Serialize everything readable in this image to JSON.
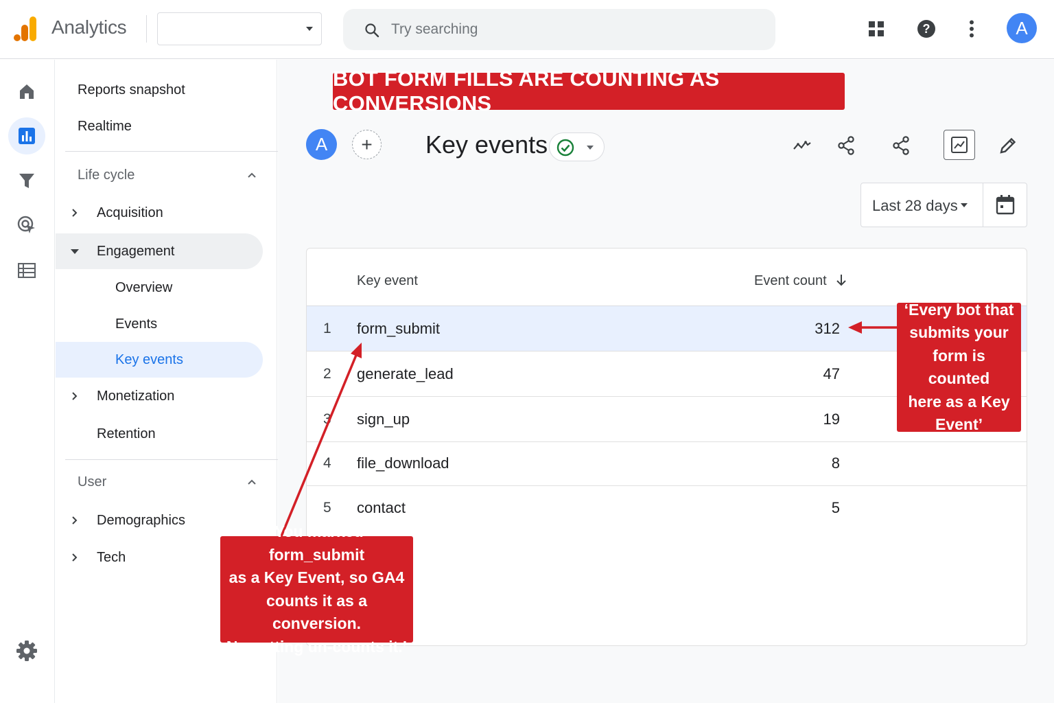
{
  "app": {
    "title": "Analytics",
    "account_selector_value": "",
    "accent_color": "#1a73e8",
    "avatar_letter": "A"
  },
  "search": {
    "placeholder": "Try searching"
  },
  "topbar_icons": [
    "apps-grid-icon",
    "help-icon",
    "more-vert-icon"
  ],
  "rail": {
    "items": [
      {
        "icon": "home-icon",
        "active": false
      },
      {
        "icon": "reports-icon",
        "active": true
      },
      {
        "icon": "explore-funnel-icon",
        "active": false
      },
      {
        "icon": "advertising-icon",
        "active": false
      },
      {
        "icon": "configure-list-icon",
        "active": false
      }
    ],
    "settings_icon": "settings-gear-icon"
  },
  "nav": {
    "reports_snapshot": "Reports snapshot",
    "realtime": "Realtime",
    "lifecycle_section": "Life cycle",
    "acquisition": "Acquisition",
    "engagement": "Engagement",
    "overview": "Overview",
    "events": "Events",
    "key_events": "Key events",
    "monetization": "Monetization",
    "retention": "Retention",
    "user_section": "User",
    "demographics": "Demographics",
    "tech": "Tech"
  },
  "banner": {
    "text": "BOT FORM FILLS ARE COUNTING AS CONVERSIONS",
    "color": "#d32027"
  },
  "report": {
    "avatar_letter": "A",
    "add_compare": "+",
    "title": "Key events",
    "status": "verified",
    "date_range": "Last 28 days"
  },
  "table": {
    "columns": [
      "Key event",
      "Event count"
    ],
    "sort": "Event count descending",
    "rows": [
      {
        "index": "1",
        "name": "form_submit",
        "count": "312",
        "highlighted": true
      },
      {
        "index": "2",
        "name": "generate_lead",
        "count": "47",
        "highlighted": false
      },
      {
        "index": "3",
        "name": "sign_up",
        "count": "19",
        "highlighted": false
      },
      {
        "index": "4",
        "name": "file_download",
        "count": "8",
        "highlighted": false
      },
      {
        "index": "5",
        "name": "contact",
        "count": "5",
        "highlighted": false
      }
    ]
  },
  "callouts": {
    "right": [
      "‘Every bot that",
      "submits your",
      "form is counted",
      "here as a Key",
      "Event’"
    ],
    "bottom": [
      "‘You marked form_submit",
      "as a Key Event, so GA4",
      "counts it as a conversion.",
      "No setting un-counts it.’"
    ]
  }
}
